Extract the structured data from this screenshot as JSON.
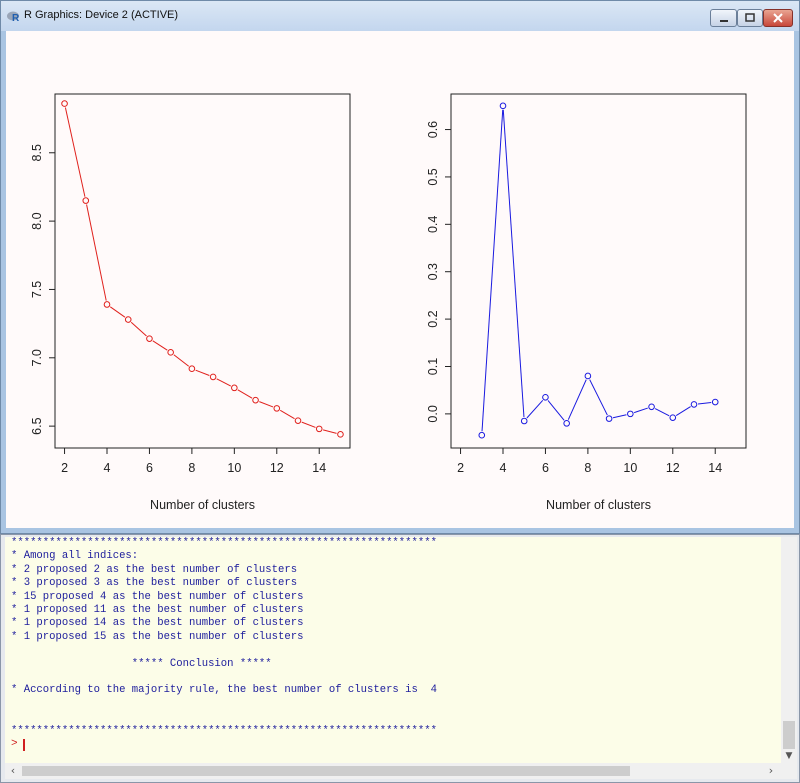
{
  "window": {
    "title": "R Graphics: Device 2 (ACTIVE)"
  },
  "colors": {
    "series_left": "#e0201c",
    "series_right": "#1a1ae0",
    "prompt": "#d02020",
    "console_text": "#1d1d9c"
  },
  "chart_data": [
    {
      "type": "line",
      "title": "",
      "xlabel": "Number of clusters",
      "ylabel": "",
      "x": [
        2,
        3,
        4,
        5,
        6,
        7,
        8,
        9,
        10,
        11,
        12,
        13,
        14,
        15
      ],
      "values": [
        8.86,
        8.15,
        7.39,
        7.28,
        7.14,
        7.04,
        6.92,
        6.86,
        6.78,
        6.69,
        6.63,
        6.54,
        6.48,
        6.44
      ],
      "xlim": [
        1.55,
        15.45
      ],
      "ylim": [
        6.34,
        8.93
      ],
      "xticks": [
        2,
        4,
        6,
        8,
        10,
        12,
        14
      ],
      "yticks": [
        6.5,
        7.0,
        7.5,
        8.0,
        8.5
      ],
      "ytick_labels": [
        "6.5",
        "7.0",
        "7.5",
        "8.0",
        "8.5"
      ],
      "grid": false,
      "marker": "open-circle"
    },
    {
      "type": "line",
      "title": "",
      "xlabel": "Number of clusters",
      "ylabel": "",
      "x": [
        3,
        4,
        5,
        6,
        7,
        8,
        9,
        10,
        11,
        12,
        13,
        14
      ],
      "values": [
        -0.045,
        0.65,
        -0.015,
        0.035,
        -0.02,
        0.08,
        -0.01,
        0.0,
        0.015,
        -0.008,
        0.02,
        0.025
      ],
      "xlim": [
        1.55,
        15.45
      ],
      "ylim": [
        -0.072,
        0.675
      ],
      "xticks": [
        2,
        4,
        6,
        8,
        10,
        12,
        14
      ],
      "yticks": [
        0.0,
        0.1,
        0.2,
        0.3,
        0.4,
        0.5,
        0.6
      ],
      "ytick_labels": [
        "0.0",
        "0.1",
        "0.2",
        "0.3",
        "0.4",
        "0.5",
        "0.6"
      ],
      "grid": false,
      "marker": "open-circle"
    }
  ],
  "console": {
    "lines": [
      "*******************************************************************",
      "* Among all indices:",
      "* 2 proposed 2 as the best number of clusters",
      "* 3 proposed 3 as the best number of clusters",
      "* 15 proposed 4 as the best number of clusters",
      "* 1 proposed 11 as the best number of clusters",
      "* 1 proposed 14 as the best number of clusters",
      "* 1 proposed 15 as the best number of clusters",
      "",
      "                   ***** Conclusion *****",
      "",
      "* According to the majority rule, the best number of clusters is  4",
      "",
      "",
      "*******************************************************************"
    ],
    "prompt": ">"
  }
}
